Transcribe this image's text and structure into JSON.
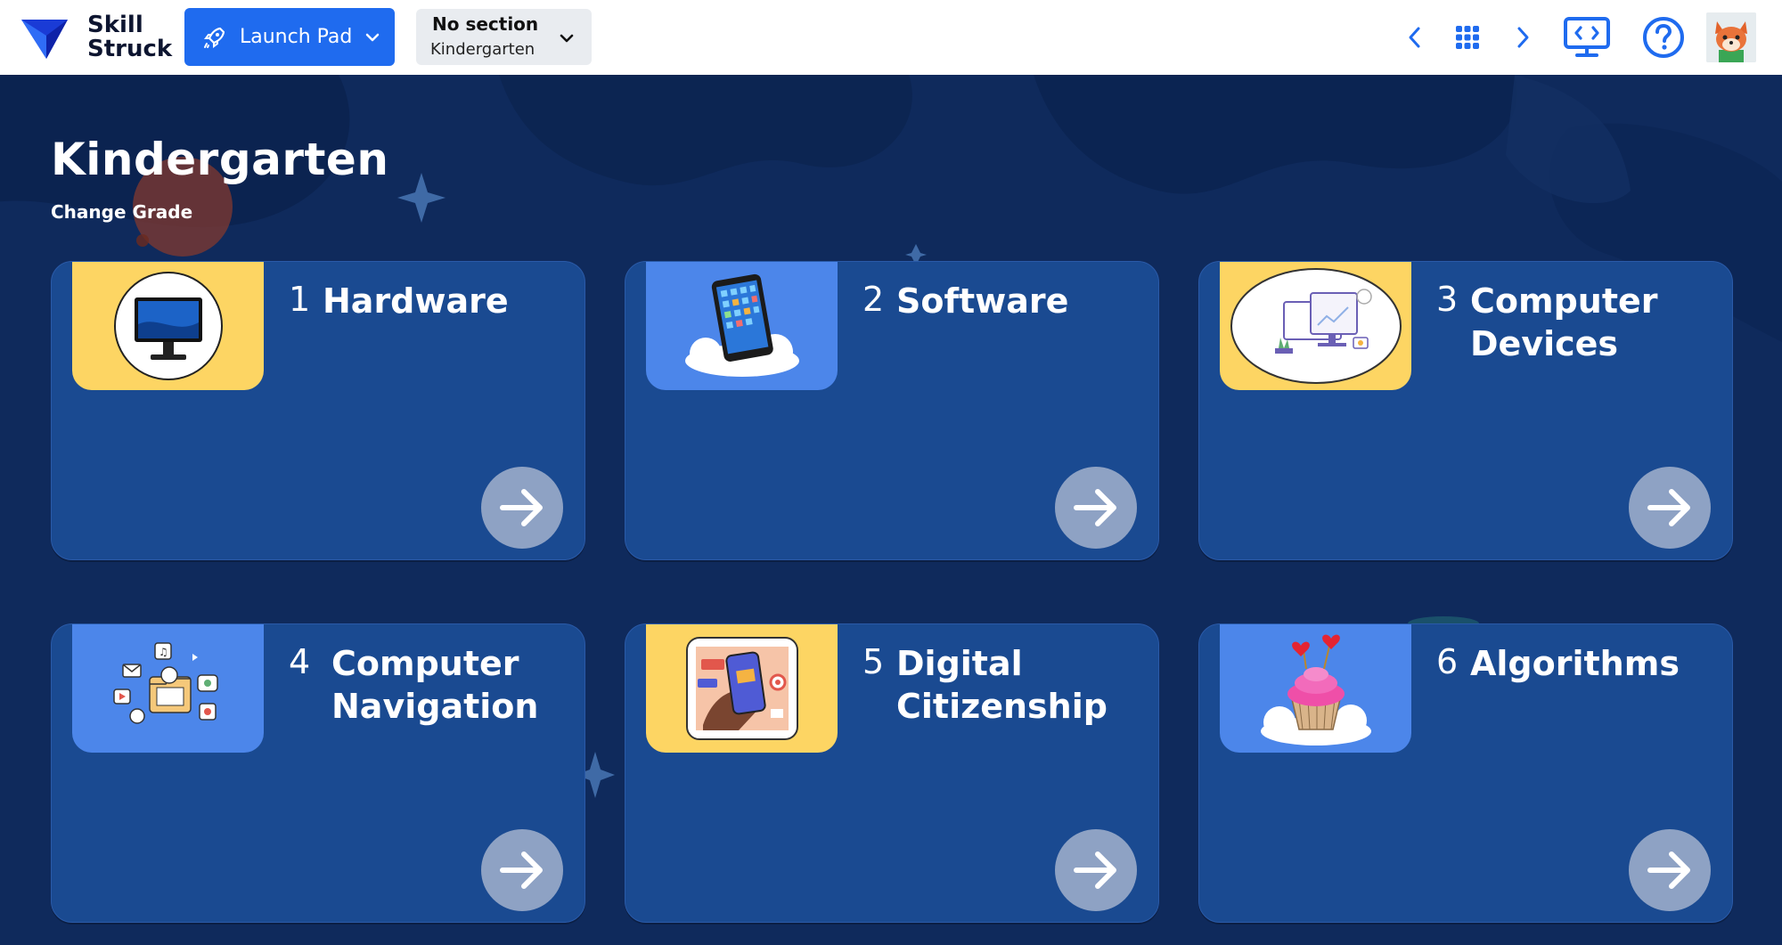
{
  "brand": {
    "name_line1": "Skill",
    "name_line2": "Struck"
  },
  "header": {
    "launch_label": "Launch Pad",
    "section_title": "No section",
    "section_value": "Kindergarten"
  },
  "main": {
    "title": "Kindergarten",
    "change_grade": "Change Grade"
  },
  "cards": [
    {
      "num": "1",
      "title": "Hardware",
      "thumb": "monitor-icon",
      "thumb_color": "#fdd563"
    },
    {
      "num": "2",
      "title": "Software",
      "thumb": "tablet-on-cloud-icon",
      "thumb_color": "#4c86ea"
    },
    {
      "num": "3",
      "title": "Computer Devices",
      "thumb": "computer-devices-icon",
      "thumb_color": "#fdd563"
    },
    {
      "num": "4",
      "title": "Computer Navigation",
      "thumb": "files-and-apps-icon",
      "thumb_color": "#4c86ea"
    },
    {
      "num": "5",
      "title": "Digital Citizenship",
      "thumb": "phone-in-hand-icon",
      "thumb_color": "#fdd563"
    },
    {
      "num": "6",
      "title": "Algorithms",
      "thumb": "cupcake-on-cloud-icon",
      "thumb_color": "#4c86ea"
    }
  ],
  "colors": {
    "accent": "#1f6bef",
    "background": "#0f2a5c",
    "card": "#1a4a91",
    "arrow_button": "#8ea2c4"
  }
}
